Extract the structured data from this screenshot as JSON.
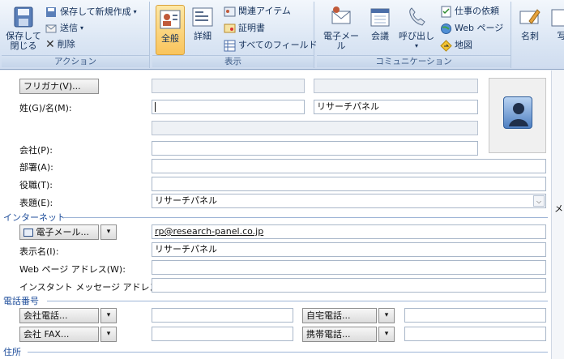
{
  "ribbon": {
    "actions": {
      "save_close": "保存して\n閉じる",
      "save_new": "保存して新規作成",
      "send": "送信",
      "delete": "削除",
      "group_label": "アクション"
    },
    "display": {
      "general": "全般",
      "details": "詳細",
      "related": "関連アイテム",
      "certificates": "証明書",
      "all_fields": "すべてのフィールド",
      "group_label": "表示"
    },
    "communication": {
      "email": "電子メール",
      "meeting": "会議",
      "call": "呼び出し",
      "task": "仕事の依頼",
      "webpage": "Web ページ",
      "map": "地図",
      "group_label": "コミュニケーション"
    },
    "options": {
      "business_card": "名刺",
      "picture": "写"
    }
  },
  "form": {
    "furigana_button": "フリガナ(V)...",
    "name_label": "姓(G)/名(M):",
    "last_name": "",
    "first_name": "リサーチパネル",
    "company_label": "会社(P):",
    "department_label": "部署(A):",
    "title_label": "役職(T):",
    "file_as_label": "表題(E):",
    "file_as_value": "リサーチパネル",
    "internet_section": "インターネット",
    "email_button": "電子メール...",
    "email_value": "rp@research-panel.co.jp",
    "display_name_label": "表示名(I):",
    "display_name_value": "リサーチパネル",
    "webpage_label": "Web ページ アドレス(W):",
    "im_label": "インスタント メッセージ アドレス(:)",
    "phone_section": "電話番号",
    "business_phone_button": "会社電話...",
    "home_phone_button": "自宅電話...",
    "business_fax_button": "会社 FAX...",
    "mobile_phone_button": "携帯電話...",
    "address_section": "住所",
    "notes_label": "メ"
  },
  "colors": {
    "accent": "#1f4e9b",
    "active_tab": "#f9c45c"
  }
}
